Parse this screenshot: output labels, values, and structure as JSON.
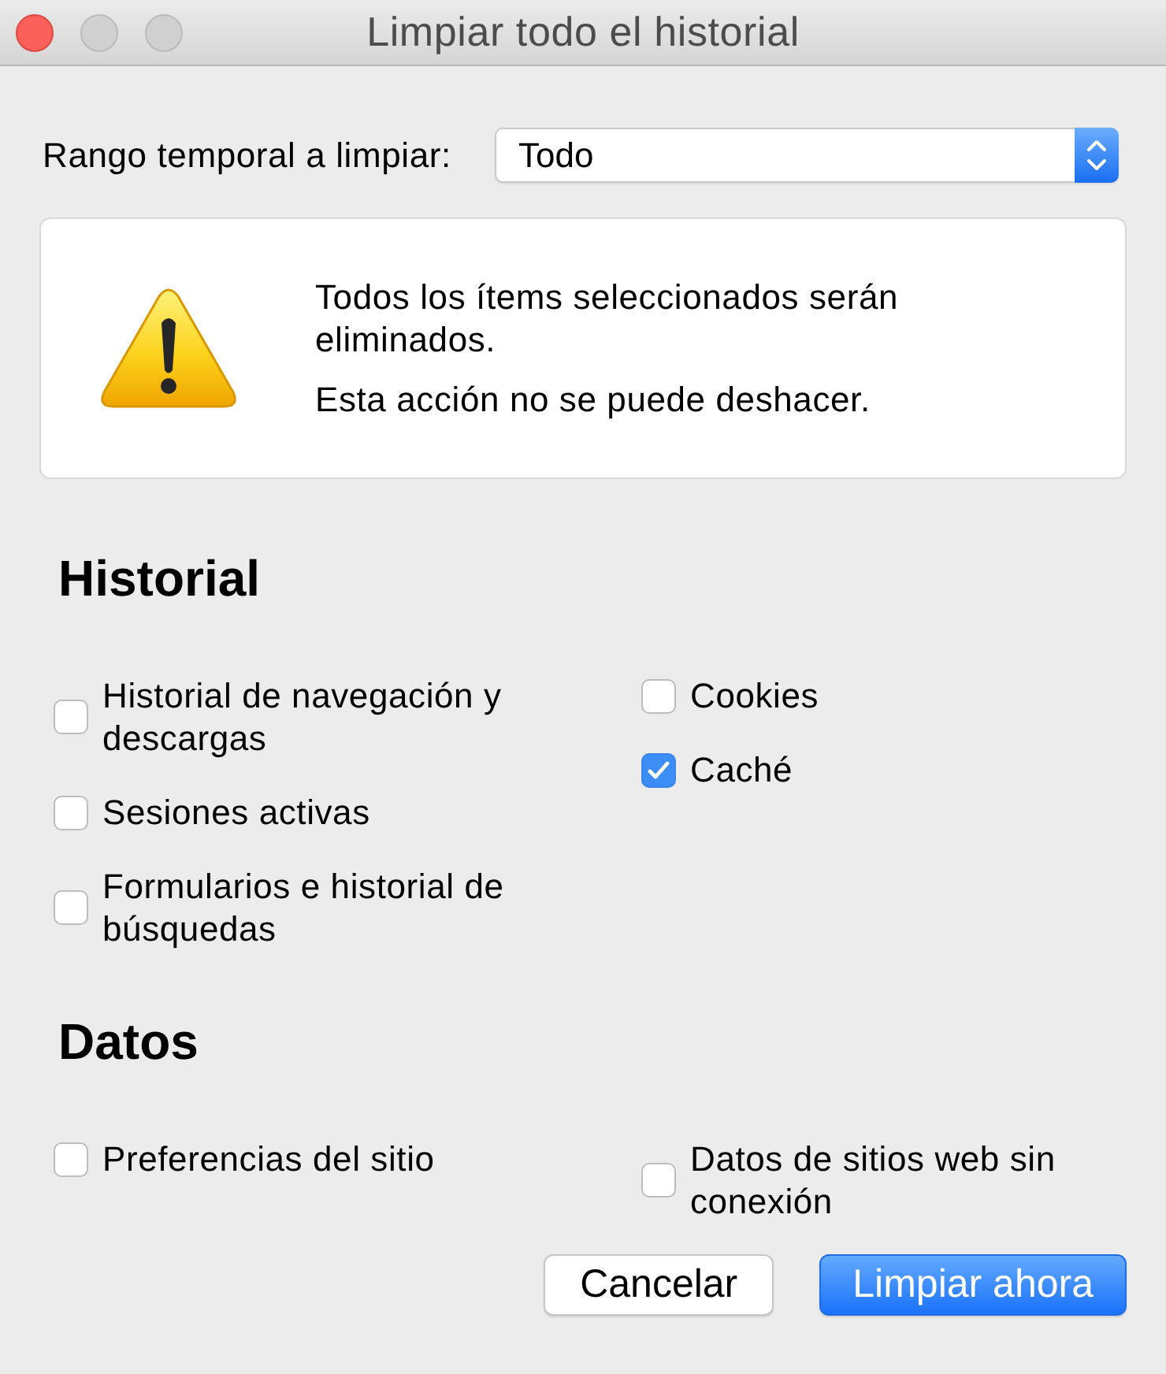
{
  "window": {
    "title": "Limpiar todo el historial",
    "controls": [
      {
        "kind": "close",
        "disabled": false
      },
      {
        "kind": "minimize",
        "disabled": true
      },
      {
        "kind": "zoom",
        "disabled": true
      }
    ]
  },
  "time_range": {
    "label": "Rango temporal a limpiar:",
    "value": "Todo"
  },
  "warning": {
    "messages": [
      "Todos los ítems seleccionados serán eliminados.",
      "Esta acción no se puede deshacer."
    ]
  },
  "sections": [
    {
      "title": "Historial",
      "columns": [
        {
          "items": [
            {
              "label": "Historial de navegación y descargas",
              "checked": false
            },
            {
              "label": "Sesiones activas",
              "checked": false
            },
            {
              "label": "Formularios e historial de búsquedas",
              "checked": false
            }
          ]
        },
        {
          "items": [
            {
              "label": "Cookies",
              "checked": false
            },
            {
              "label": "Caché",
              "checked": true
            }
          ]
        }
      ]
    },
    {
      "title": "Datos",
      "columns": [
        {
          "items": [
            {
              "label": "Preferencias del sitio",
              "checked": false
            }
          ]
        },
        {
          "items": [
            {
              "label": "Datos de sitios web sin conexión",
              "checked": false
            }
          ]
        }
      ]
    }
  ],
  "buttons": [
    {
      "label": "Cancelar",
      "default": false
    },
    {
      "label": "Limpiar ahora",
      "default": true
    }
  ]
}
